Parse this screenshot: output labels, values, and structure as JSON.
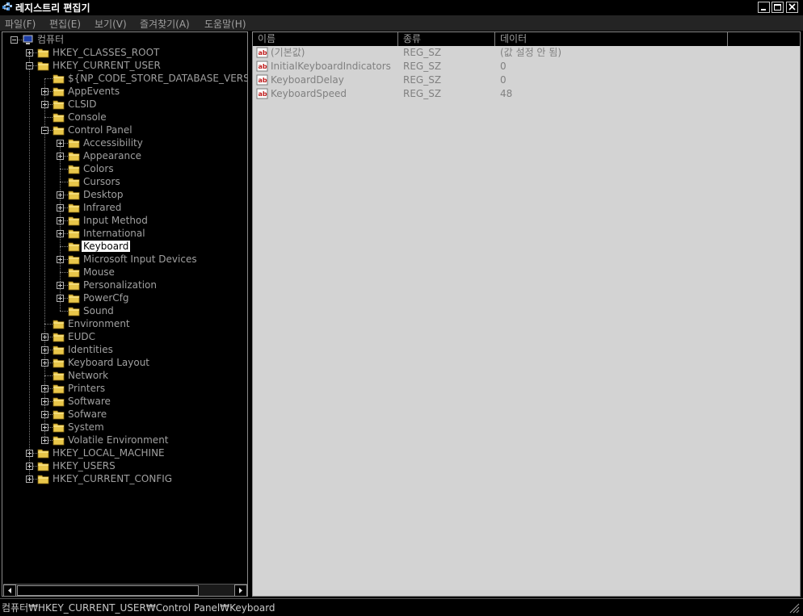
{
  "window": {
    "title": "레지스트리 편집기"
  },
  "menu": [
    "파일(F)",
    "편집(E)",
    "보기(V)",
    "즐겨찾기(A)",
    "도움말(H)"
  ],
  "tree": [
    {
      "label": "컴퓨터",
      "level": 0,
      "expander": "minus",
      "icon": "computer-icon"
    },
    {
      "label": "HKEY_CLASSES_ROOT",
      "level": 1,
      "expander": "plus"
    },
    {
      "label": "HKEY_CURRENT_USER",
      "level": 1,
      "expander": "minus"
    },
    {
      "label": "${NP_CODE_STORE_DATABASE_VERSION}",
      "level": 2,
      "expander": "none"
    },
    {
      "label": "AppEvents",
      "level": 2,
      "expander": "plus"
    },
    {
      "label": "CLSID",
      "level": 2,
      "expander": "plus"
    },
    {
      "label": "Console",
      "level": 2,
      "expander": "none"
    },
    {
      "label": "Control Panel",
      "level": 2,
      "expander": "minus"
    },
    {
      "label": "Accessibility",
      "level": 3,
      "expander": "plus"
    },
    {
      "label": "Appearance",
      "level": 3,
      "expander": "plus"
    },
    {
      "label": "Colors",
      "level": 3,
      "expander": "none"
    },
    {
      "label": "Cursors",
      "level": 3,
      "expander": "none"
    },
    {
      "label": "Desktop",
      "level": 3,
      "expander": "plus"
    },
    {
      "label": "Infrared",
      "level": 3,
      "expander": "plus"
    },
    {
      "label": "Input Method",
      "level": 3,
      "expander": "plus"
    },
    {
      "label": "International",
      "level": 3,
      "expander": "plus"
    },
    {
      "label": "Keyboard",
      "level": 3,
      "expander": "none",
      "selected": true
    },
    {
      "label": "Microsoft Input Devices",
      "level": 3,
      "expander": "plus"
    },
    {
      "label": "Mouse",
      "level": 3,
      "expander": "none"
    },
    {
      "label": "Personalization",
      "level": 3,
      "expander": "plus"
    },
    {
      "label": "PowerCfg",
      "level": 3,
      "expander": "plus"
    },
    {
      "label": "Sound",
      "level": 3,
      "expander": "none"
    },
    {
      "label": "Environment",
      "level": 2,
      "expander": "none"
    },
    {
      "label": "EUDC",
      "level": 2,
      "expander": "plus"
    },
    {
      "label": "Identities",
      "level": 2,
      "expander": "plus"
    },
    {
      "label": "Keyboard Layout",
      "level": 2,
      "expander": "plus"
    },
    {
      "label": "Network",
      "level": 2,
      "expander": "none"
    },
    {
      "label": "Printers",
      "level": 2,
      "expander": "plus"
    },
    {
      "label": "Software",
      "level": 2,
      "expander": "plus"
    },
    {
      "label": "Sofware",
      "level": 2,
      "expander": "plus"
    },
    {
      "label": "System",
      "level": 2,
      "expander": "plus"
    },
    {
      "label": "Volatile Environment",
      "level": 2,
      "expander": "plus"
    },
    {
      "label": "HKEY_LOCAL_MACHINE",
      "level": 1,
      "expander": "plus"
    },
    {
      "label": "HKEY_USERS",
      "level": 1,
      "expander": "plus"
    },
    {
      "label": "HKEY_CURRENT_CONFIG",
      "level": 1,
      "expander": "plus"
    }
  ],
  "list": {
    "columns": [
      "이름",
      "종류",
      "데이터"
    ],
    "rows": [
      {
        "name": "(기본값)",
        "type": "REG_SZ",
        "data": "(값 설정 안 됨)",
        "icon": "string-value-icon"
      },
      {
        "name": "InitialKeyboardIndicators",
        "type": "REG_SZ",
        "data": "0",
        "icon": "string-value-icon"
      },
      {
        "name": "KeyboardDelay",
        "type": "REG_SZ",
        "data": "0",
        "icon": "string-value-icon"
      },
      {
        "name": "KeyboardSpeed",
        "type": "REG_SZ",
        "data": "48",
        "icon": "string-value-icon"
      }
    ]
  },
  "status": {
    "path": "컴퓨터₩HKEY_CURRENT_USER₩Control Panel₩Keyboard"
  },
  "colors": {
    "background": "#000000",
    "list_background": "#d3d3d3",
    "text": "#a0a0a0",
    "folder": "#e8c64a"
  }
}
